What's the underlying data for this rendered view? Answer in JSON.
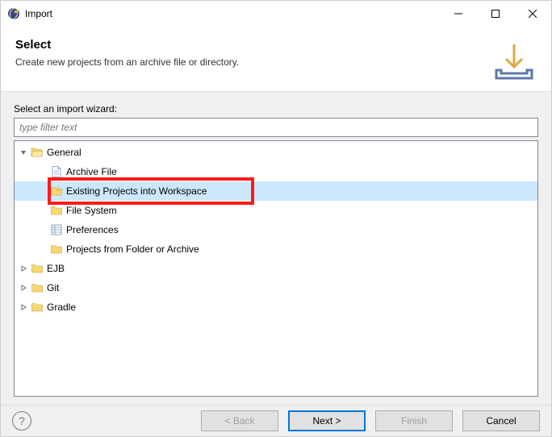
{
  "window": {
    "title": "Import"
  },
  "header": {
    "title": "Select",
    "subtitle": "Create new projects from an archive file or directory."
  },
  "content": {
    "label": "Select an import wizard:",
    "filter_placeholder": "type filter text",
    "filter_value": ""
  },
  "tree": {
    "nodes": [
      {
        "label": "General",
        "level": 0,
        "expanded": true,
        "icon": "folder-open"
      },
      {
        "label": "Archive File",
        "level": 1,
        "icon": "file"
      },
      {
        "label": "Existing Projects into Workspace",
        "level": 1,
        "icon": "folder-import",
        "selected": true
      },
      {
        "label": "File System",
        "level": 1,
        "icon": "folder-closed"
      },
      {
        "label": "Preferences",
        "level": 1,
        "icon": "preferences"
      },
      {
        "label": "Projects from Folder or Archive",
        "level": 1,
        "icon": "folder-closed"
      },
      {
        "label": "EJB",
        "level": 0,
        "expanded": false,
        "icon": "folder-closed"
      },
      {
        "label": "Git",
        "level": 0,
        "expanded": false,
        "icon": "folder-closed"
      },
      {
        "label": "Gradle",
        "level": 0,
        "expanded": false,
        "icon": "folder-closed"
      }
    ]
  },
  "buttons": {
    "back": "< Back",
    "next": "Next >",
    "finish": "Finish",
    "cancel": "Cancel"
  },
  "annotation": {
    "highlight_target": "Existing Projects into Workspace"
  }
}
